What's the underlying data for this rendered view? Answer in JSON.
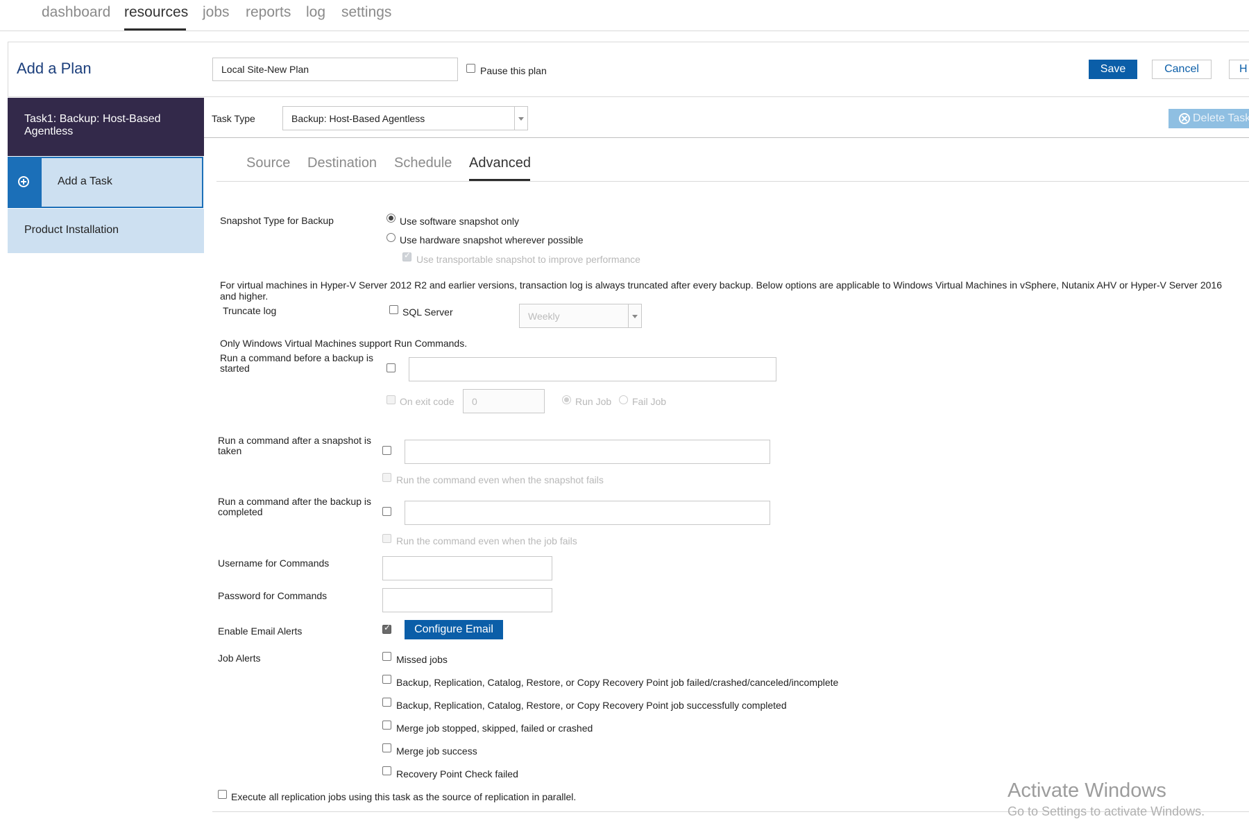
{
  "nav": {
    "items": [
      "dashboard",
      "resources",
      "jobs",
      "reports",
      "log",
      "settings"
    ],
    "active": "resources"
  },
  "header": {
    "title": "Add a Plan",
    "plan_name": "Local Site-New Plan",
    "pause_label": "Pause this plan",
    "save_label": "Save",
    "cancel_label": "Cancel",
    "help_label": "H"
  },
  "sidebar": {
    "task_label": "Task1: Backup: Host-Based Agentless",
    "add_task_label": "Add a Task",
    "product_install_label": "Product Installation"
  },
  "task": {
    "type_label": "Task Type",
    "type_value": "Backup: Host-Based Agentless",
    "delete_label": "Delete Task"
  },
  "tabs": [
    "Source",
    "Destination",
    "Schedule",
    "Advanced"
  ],
  "advanced": {
    "snapshot_label": "Snapshot Type for Backup",
    "snapshot_opt1": "Use software snapshot only",
    "snapshot_opt2": "Use hardware snapshot wherever possible",
    "snapshot_opt3": "Use transportable snapshot to improve performance",
    "note_hyperv": "For virtual machines in Hyper-V Server 2012 R2 and earlier versions, transaction log is always truncated after every backup. Below options are applicable to Windows Virtual Machines in vSphere, Nutanix AHV or Hyper-V Server 2016 and higher.",
    "truncate_label": "Truncate log",
    "sql_label": "SQL Server",
    "frequency_value": "Weekly",
    "run_note": "Only Windows Virtual Machines support Run Commands.",
    "run_before_label": "Run a command before a backup is started",
    "on_exit_label": "On exit code",
    "exit_code_value": "0",
    "run_job_label": "Run Job",
    "fail_job_label": "Fail Job",
    "run_after_snapshot_label": "Run a command after a snapshot is taken",
    "run_even_snapshot_label": "Run the command even when the snapshot fails",
    "run_after_backup_label": "Run a command after the backup is completed",
    "run_even_job_label": "Run the command even when the job fails",
    "username_label": "Username for Commands",
    "password_label": "Password for Commands",
    "email_alerts_label": "Enable Email Alerts",
    "configure_email_label": "Configure Email",
    "job_alerts_label": "Job Alerts",
    "job_alerts": [
      "Missed jobs",
      "Backup, Replication, Catalog, Restore, or Copy Recovery Point job failed/crashed/canceled/incomplete",
      "Backup, Replication, Catalog, Restore, or Copy Recovery Point job successfully completed",
      "Merge job stopped, skipped, failed or crashed",
      "Merge job success",
      "Recovery Point Check failed"
    ],
    "parallel_label": "Execute all replication jobs using this task as the source of replication in parallel."
  },
  "watermark": {
    "line1": "Activate Windows",
    "line2": "Go to Settings to activate Windows."
  },
  "colors": {
    "primary": "#0b5ea8",
    "sidebar_dark": "#33294a",
    "sidebar_light": "#cde0f1",
    "title_blue": "#1c3f7c"
  }
}
